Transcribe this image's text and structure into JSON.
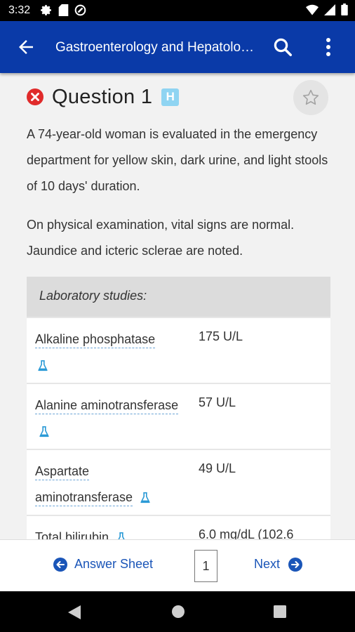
{
  "status_bar": {
    "time": "3:32",
    "icons_left": [
      "gear-icon",
      "sd-card-icon",
      "no-disturb-icon"
    ],
    "icons_right": [
      "wifi-icon",
      "signal-icon",
      "battery-icon"
    ]
  },
  "app_bar": {
    "title": "Gastroenterology and Hepatolo…",
    "back_icon": "arrow-back-icon",
    "search_icon": "search-icon",
    "more_icon": "more-vert-icon"
  },
  "question": {
    "title": "Question 1",
    "badge": "H",
    "status_icon": "incorrect-icon",
    "paragraphs": [
      "A 74-year-old woman is evaluated in the emergency department for yellow skin, dark urine, and light stools of 10 days' duration.",
      "On physical examination, vital signs are normal. Jaundice and icteric sclerae are noted."
    ]
  },
  "lab": {
    "heading": "Laboratory studies:",
    "rows": [
      {
        "name": "Alkaline phosphatase",
        "value": "175 U/L"
      },
      {
        "name": "Alanine aminotransferase",
        "value": "57 U/L"
      },
      {
        "name": "Aspartate aminotransferase",
        "value": "49 U/L"
      },
      {
        "name": "Total bilirubin",
        "value": "6.0 mg/dL (102.6"
      }
    ]
  },
  "bottom": {
    "answer_sheet": "Answer Sheet",
    "page": "1",
    "next": "Next"
  },
  "colors": {
    "app_bar": "#0a3aa8",
    "accent": "#1a55b8",
    "incorrect": "#e02b2b",
    "badge": "#8fd4f2"
  }
}
